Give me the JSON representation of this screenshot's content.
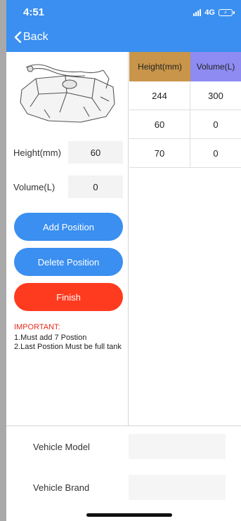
{
  "status_bar": {
    "time": "4:51",
    "network": "4G"
  },
  "nav": {
    "back_label": "Back"
  },
  "form": {
    "height_label": "Height(mm)",
    "height_value": "60",
    "volume_label": "Volume(L)",
    "volume_value": "0"
  },
  "buttons": {
    "add": "Add Position",
    "delete": "Delete Position",
    "finish": "Finish"
  },
  "important": {
    "title": "IMPORTANT:",
    "line1": "1.Must add 7 Postion",
    "line2": "2.Last Postion Must be full tank"
  },
  "table": {
    "headers": [
      "Height(mm)",
      "Volume(L)"
    ],
    "rows": [
      [
        "244",
        "300"
      ],
      [
        "60",
        "0"
      ],
      [
        "70",
        "0"
      ]
    ]
  },
  "vehicle": {
    "model_label": "Vehicle Model",
    "model_value": "",
    "brand_label": "Vehicle Brand",
    "brand_value": ""
  },
  "colors": {
    "primary": "#3a8ff0",
    "danger": "#ff3b1f",
    "header_height": "#c8954a",
    "header_volume": "#8e8cf2",
    "important_text": "#e52b1e"
  },
  "icons": {
    "back": "chevron-left-icon",
    "tank": "fuel-tank-icon",
    "signal": "signal-icon",
    "battery": "battery-charging-icon"
  }
}
